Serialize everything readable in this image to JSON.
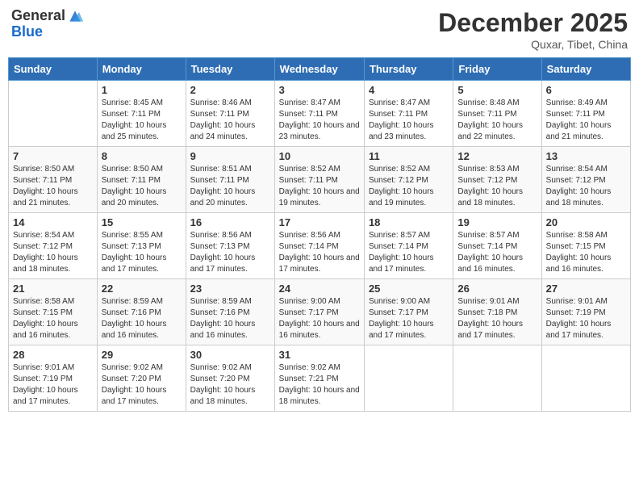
{
  "header": {
    "logo_general": "General",
    "logo_blue": "Blue",
    "month_title": "December 2025",
    "subtitle": "Quxar, Tibet, China"
  },
  "weekdays": [
    "Sunday",
    "Monday",
    "Tuesday",
    "Wednesday",
    "Thursday",
    "Friday",
    "Saturday"
  ],
  "weeks": [
    [
      {
        "day": "",
        "sunrise": "",
        "sunset": "",
        "daylight": ""
      },
      {
        "day": "1",
        "sunrise": "Sunrise: 8:45 AM",
        "sunset": "Sunset: 7:11 PM",
        "daylight": "Daylight: 10 hours and 25 minutes."
      },
      {
        "day": "2",
        "sunrise": "Sunrise: 8:46 AM",
        "sunset": "Sunset: 7:11 PM",
        "daylight": "Daylight: 10 hours and 24 minutes."
      },
      {
        "day": "3",
        "sunrise": "Sunrise: 8:47 AM",
        "sunset": "Sunset: 7:11 PM",
        "daylight": "Daylight: 10 hours and 23 minutes."
      },
      {
        "day": "4",
        "sunrise": "Sunrise: 8:47 AM",
        "sunset": "Sunset: 7:11 PM",
        "daylight": "Daylight: 10 hours and 23 minutes."
      },
      {
        "day": "5",
        "sunrise": "Sunrise: 8:48 AM",
        "sunset": "Sunset: 7:11 PM",
        "daylight": "Daylight: 10 hours and 22 minutes."
      },
      {
        "day": "6",
        "sunrise": "Sunrise: 8:49 AM",
        "sunset": "Sunset: 7:11 PM",
        "daylight": "Daylight: 10 hours and 21 minutes."
      }
    ],
    [
      {
        "day": "7",
        "sunrise": "Sunrise: 8:50 AM",
        "sunset": "Sunset: 7:11 PM",
        "daylight": "Daylight: 10 hours and 21 minutes."
      },
      {
        "day": "8",
        "sunrise": "Sunrise: 8:50 AM",
        "sunset": "Sunset: 7:11 PM",
        "daylight": "Daylight: 10 hours and 20 minutes."
      },
      {
        "day": "9",
        "sunrise": "Sunrise: 8:51 AM",
        "sunset": "Sunset: 7:11 PM",
        "daylight": "Daylight: 10 hours and 20 minutes."
      },
      {
        "day": "10",
        "sunrise": "Sunrise: 8:52 AM",
        "sunset": "Sunset: 7:11 PM",
        "daylight": "Daylight: 10 hours and 19 minutes."
      },
      {
        "day": "11",
        "sunrise": "Sunrise: 8:52 AM",
        "sunset": "Sunset: 7:12 PM",
        "daylight": "Daylight: 10 hours and 19 minutes."
      },
      {
        "day": "12",
        "sunrise": "Sunrise: 8:53 AM",
        "sunset": "Sunset: 7:12 PM",
        "daylight": "Daylight: 10 hours and 18 minutes."
      },
      {
        "day": "13",
        "sunrise": "Sunrise: 8:54 AM",
        "sunset": "Sunset: 7:12 PM",
        "daylight": "Daylight: 10 hours and 18 minutes."
      }
    ],
    [
      {
        "day": "14",
        "sunrise": "Sunrise: 8:54 AM",
        "sunset": "Sunset: 7:12 PM",
        "daylight": "Daylight: 10 hours and 18 minutes."
      },
      {
        "day": "15",
        "sunrise": "Sunrise: 8:55 AM",
        "sunset": "Sunset: 7:13 PM",
        "daylight": "Daylight: 10 hours and 17 minutes."
      },
      {
        "day": "16",
        "sunrise": "Sunrise: 8:56 AM",
        "sunset": "Sunset: 7:13 PM",
        "daylight": "Daylight: 10 hours and 17 minutes."
      },
      {
        "day": "17",
        "sunrise": "Sunrise: 8:56 AM",
        "sunset": "Sunset: 7:14 PM",
        "daylight": "Daylight: 10 hours and 17 minutes."
      },
      {
        "day": "18",
        "sunrise": "Sunrise: 8:57 AM",
        "sunset": "Sunset: 7:14 PM",
        "daylight": "Daylight: 10 hours and 17 minutes."
      },
      {
        "day": "19",
        "sunrise": "Sunrise: 8:57 AM",
        "sunset": "Sunset: 7:14 PM",
        "daylight": "Daylight: 10 hours and 16 minutes."
      },
      {
        "day": "20",
        "sunrise": "Sunrise: 8:58 AM",
        "sunset": "Sunset: 7:15 PM",
        "daylight": "Daylight: 10 hours and 16 minutes."
      }
    ],
    [
      {
        "day": "21",
        "sunrise": "Sunrise: 8:58 AM",
        "sunset": "Sunset: 7:15 PM",
        "daylight": "Daylight: 10 hours and 16 minutes."
      },
      {
        "day": "22",
        "sunrise": "Sunrise: 8:59 AM",
        "sunset": "Sunset: 7:16 PM",
        "daylight": "Daylight: 10 hours and 16 minutes."
      },
      {
        "day": "23",
        "sunrise": "Sunrise: 8:59 AM",
        "sunset": "Sunset: 7:16 PM",
        "daylight": "Daylight: 10 hours and 16 minutes."
      },
      {
        "day": "24",
        "sunrise": "Sunrise: 9:00 AM",
        "sunset": "Sunset: 7:17 PM",
        "daylight": "Daylight: 10 hours and 16 minutes."
      },
      {
        "day": "25",
        "sunrise": "Sunrise: 9:00 AM",
        "sunset": "Sunset: 7:17 PM",
        "daylight": "Daylight: 10 hours and 17 minutes."
      },
      {
        "day": "26",
        "sunrise": "Sunrise: 9:01 AM",
        "sunset": "Sunset: 7:18 PM",
        "daylight": "Daylight: 10 hours and 17 minutes."
      },
      {
        "day": "27",
        "sunrise": "Sunrise: 9:01 AM",
        "sunset": "Sunset: 7:19 PM",
        "daylight": "Daylight: 10 hours and 17 minutes."
      }
    ],
    [
      {
        "day": "28",
        "sunrise": "Sunrise: 9:01 AM",
        "sunset": "Sunset: 7:19 PM",
        "daylight": "Daylight: 10 hours and 17 minutes."
      },
      {
        "day": "29",
        "sunrise": "Sunrise: 9:02 AM",
        "sunset": "Sunset: 7:20 PM",
        "daylight": "Daylight: 10 hours and 17 minutes."
      },
      {
        "day": "30",
        "sunrise": "Sunrise: 9:02 AM",
        "sunset": "Sunset: 7:20 PM",
        "daylight": "Daylight: 10 hours and 18 minutes."
      },
      {
        "day": "31",
        "sunrise": "Sunrise: 9:02 AM",
        "sunset": "Sunset: 7:21 PM",
        "daylight": "Daylight: 10 hours and 18 minutes."
      },
      {
        "day": "",
        "sunrise": "",
        "sunset": "",
        "daylight": ""
      },
      {
        "day": "",
        "sunrise": "",
        "sunset": "",
        "daylight": ""
      },
      {
        "day": "",
        "sunrise": "",
        "sunset": "",
        "daylight": ""
      }
    ]
  ]
}
